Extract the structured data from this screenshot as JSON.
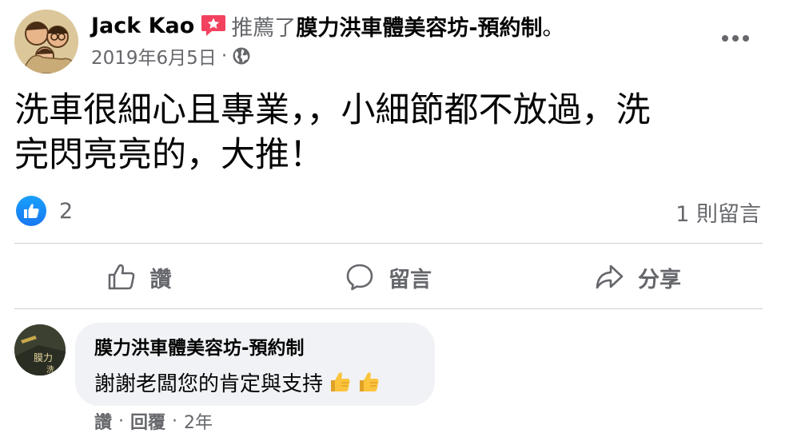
{
  "post": {
    "author": "Jack Kao",
    "recommend_verb": "推薦了",
    "page_name": "膜力洪車體美容坊-預約制",
    "period": "。",
    "date": "2019年6月5日",
    "meta_sep": "·",
    "privacy_icon": "globe-icon",
    "text_line1": "洗車很細心且專業，，小細節都不放過，洗",
    "text_line2": "完閃亮亮的，大推！"
  },
  "reactions": {
    "type_icon": "like-icon",
    "count": "2",
    "comments_label": "1 則留言"
  },
  "actions": {
    "like_label": "讚",
    "comment_label": "留言",
    "share_label": "分享"
  },
  "comment": {
    "author": "膜力洪車體美容坊-預約制",
    "text": "謝謝老闆您的肯定與支持",
    "avatar_text_top": "膜力",
    "avatar_text_bottom": "洗",
    "like_label": "讚",
    "sep": "·",
    "reply_label": "回覆",
    "time": "2年"
  },
  "colors": {
    "accent_blue": "#1877f2",
    "secondary_text": "#65676b",
    "bubble_bg": "#f0f2f5",
    "divider": "#ced0d4",
    "recommend_badge": "#f3425f"
  }
}
